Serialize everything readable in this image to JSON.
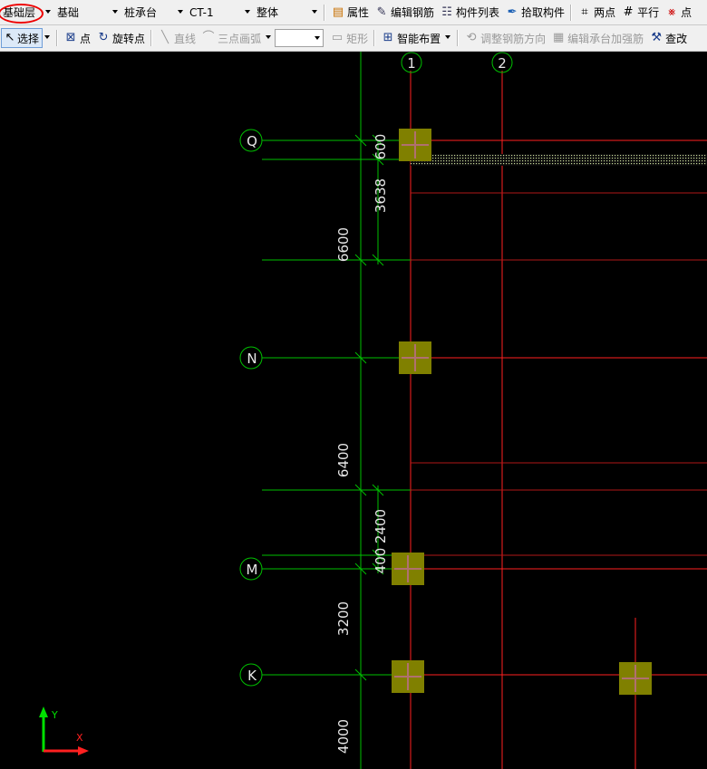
{
  "toolbar1": {
    "floor": "基础层",
    "category": "基础",
    "component_type": "桩承台",
    "component_name": "CT-1",
    "scope": "整体",
    "properties": "属性",
    "edit_rebar": "编辑钢筋",
    "component_list": "构件列表",
    "pick_component": "拾取构件",
    "two_points": "两点",
    "parallel": "平行",
    "point_angle": "点"
  },
  "toolbar2": {
    "select": "选择",
    "point": "点",
    "rotate_point": "旋转点",
    "line": "直线",
    "three_point_arc": "三点画弧",
    "rectangle": "矩形",
    "smart_layout": "智能布置",
    "adjust_rebar_direction": "调整钢筋方向",
    "edit_cap_rebar": "编辑承台加强筋",
    "check_modify": "查改"
  },
  "canvas": {
    "axis_top": [
      "1",
      "2"
    ],
    "axis_left": [
      "Q",
      "N",
      "M",
      "K"
    ],
    "dims_outer": [
      "6600",
      "6400",
      "3200",
      "4000"
    ],
    "dims_inner": [
      "600",
      "3638",
      "2400",
      "400"
    ],
    "ucs_y": "Y",
    "ucs_x": "X"
  },
  "colors": {
    "background": "#000000",
    "grid_line": "#ff2020",
    "dim_line": "#00c000",
    "pile_cap": "#808000",
    "highlight": "#e00000"
  }
}
